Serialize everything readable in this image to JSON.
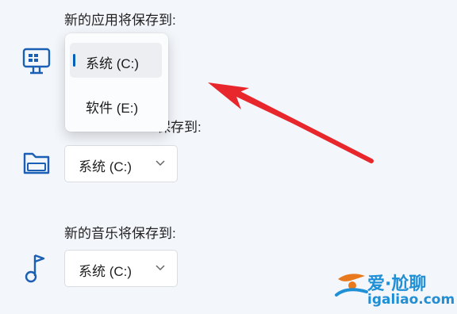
{
  "sections": [
    {
      "label": "新的应用将保存到:",
      "icon": "monitor-app-icon"
    },
    {
      "label": "保存到:",
      "icon": "folder-drive-icon",
      "selected": "系统 (C:)"
    },
    {
      "label": "新的音乐将保存到:",
      "icon": "music-note-icon",
      "selected": "系统 (C:)"
    }
  ],
  "flyout": {
    "options": [
      "系统 (C:)",
      "软件 (E:)"
    ],
    "selected_index": 0
  },
  "watermark": {
    "name": "爱·尬聊",
    "url": "igaliao.com"
  },
  "colors": {
    "accent": "#005fb8",
    "icon": "#1a5fb4",
    "arrow": "#e8272d",
    "background": "#f3f6fb"
  }
}
